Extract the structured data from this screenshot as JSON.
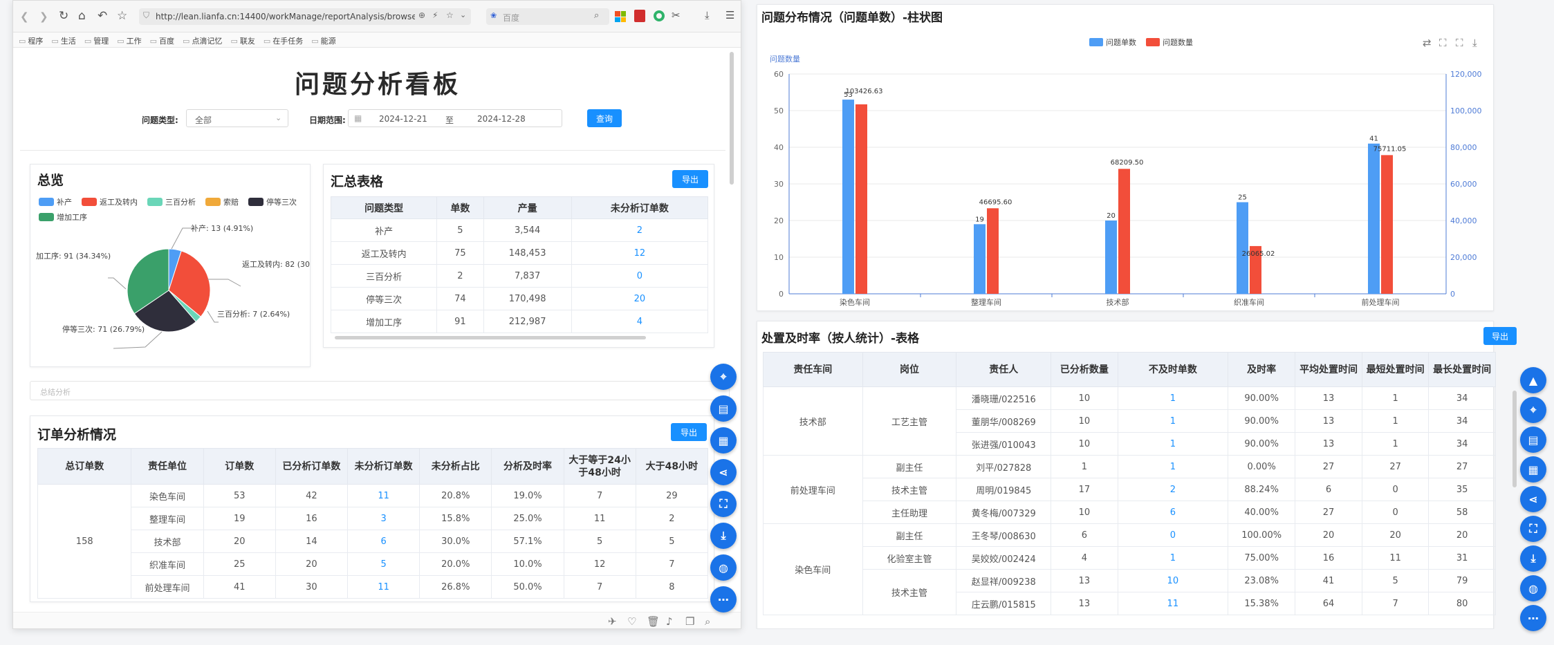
{
  "browser": {
    "url": "http://lean.lianfa.cn:14400/workManage/reportAnalysis/browse",
    "search_placeholder": "百度",
    "bookmarks": [
      "程序",
      "生活",
      "管理",
      "工作",
      "百度",
      "点滴记忆",
      "联友",
      "在手任务",
      "能源"
    ]
  },
  "page": {
    "title": "问题分析看板",
    "filter_type_label": "问题类型:",
    "filter_type_value": "全部",
    "filter_date_label": "日期范围:",
    "date_start": "2024-12-21",
    "date_sep": "至",
    "date_end": "2024-12-28",
    "query_label": "查询"
  },
  "overview": {
    "title": "总览",
    "legend": [
      {
        "name": "补产",
        "color": "#4e9df5"
      },
      {
        "name": "返工及转内",
        "color": "#f24e3a"
      },
      {
        "name": "三百分析",
        "color": "#6ad6b8"
      },
      {
        "name": "索赔",
        "color": "#f0a93a"
      },
      {
        "name": "停等三次",
        "color": "#2f2e3b"
      },
      {
        "name": "增加工序",
        "color": "#3aa06a"
      }
    ],
    "labels": [
      "补产: 13 (4.91%)",
      "返工及转内: 82 (30",
      "三百分析: 7 (2.64%)",
      "停等三次: 71 (26.79%)",
      "加工序: 91 (34.34%)"
    ]
  },
  "summary": {
    "title": "汇总表格",
    "export_label": "导出",
    "headers": [
      "问题类型",
      "单数",
      "产量",
      "未分析订单数"
    ],
    "rows": [
      [
        "补产",
        "5",
        "3,544",
        "2"
      ],
      [
        "返工及转内",
        "75",
        "148,453",
        "12"
      ],
      [
        "三百分析",
        "2",
        "7,837",
        "0"
      ],
      [
        "停等三次",
        "74",
        "170,498",
        "20"
      ],
      [
        "增加工序",
        "91",
        "212,987",
        "4"
      ]
    ]
  },
  "summary_input": {
    "placeholder": "总结分析"
  },
  "order": {
    "title": "订单分析情况",
    "export_label": "导出",
    "headers": [
      "总订单数",
      "责任单位",
      "订单数",
      "已分析订单数",
      "未分析订单数",
      "未分析占比",
      "分析及时率",
      "大于等于24小于48小时",
      "大于48小时"
    ],
    "total": "158",
    "rows": [
      [
        "染色车间",
        "53",
        "42",
        "11",
        "20.8%",
        "19.0%",
        "7",
        "29"
      ],
      [
        "整理车间",
        "19",
        "16",
        "3",
        "15.8%",
        "25.0%",
        "11",
        "2"
      ],
      [
        "技术部",
        "20",
        "14",
        "6",
        "30.0%",
        "57.1%",
        "5",
        "5"
      ],
      [
        "织准车间",
        "25",
        "20",
        "5",
        "20.0%",
        "10.0%",
        "12",
        "7"
      ],
      [
        "前处理车间",
        "41",
        "30",
        "11",
        "26.8%",
        "50.0%",
        "7",
        "8"
      ]
    ]
  },
  "chart_data": {
    "type": "bar",
    "title": "问题分布情况（问题单数）-柱状图",
    "ylabel": "问题数量",
    "categories": [
      "染色车间",
      "整理车间",
      "技术部",
      "织准车间",
      "前处理车间"
    ],
    "ylim": [
      0,
      60
    ],
    "y2lim": [
      0,
      120000
    ],
    "yticks": [
      "0",
      "10",
      "20",
      "30",
      "40",
      "50",
      "60"
    ],
    "y2ticks": [
      "0",
      "20,000",
      "40,000",
      "60,000",
      "80,000",
      "100,000",
      "120,000"
    ],
    "series": [
      {
        "name": "问题单数",
        "color": "#4e9df5",
        "axis": "left",
        "values": [
          53,
          19,
          20,
          25,
          41
        ],
        "labels": [
          "53",
          "19",
          "20",
          "25",
          "41"
        ]
      },
      {
        "name": "问题数量",
        "color": "#f24e3a",
        "axis": "right",
        "values": [
          103426.63,
          46695.6,
          68209.5,
          26065.02,
          75711.05
        ],
        "labels": [
          "103426.63",
          "46695.60",
          "68209.50",
          "26065.02",
          "75711.05"
        ]
      }
    ],
    "legend_position": "top-center"
  },
  "rate": {
    "title": "处置及时率（按人统计）-表格",
    "export_label": "导出",
    "headers": [
      "责任车间",
      "岗位",
      "责任人",
      "已分析数量",
      "不及时单数",
      "及时率",
      "平均处置时间",
      "最短处置时间",
      "最长处置时间"
    ],
    "groups": [
      {
        "dept": "技术部",
        "posts": [
          {
            "post": "工艺主管",
            "people": [
              [
                "潘晓珊/022516",
                "10",
                "1",
                "90.00%",
                "13",
                "1",
                "34"
              ],
              [
                "董朋华/008269",
                "10",
                "1",
                "90.00%",
                "13",
                "1",
                "34"
              ],
              [
                "张进强/010043",
                "10",
                "1",
                "90.00%",
                "13",
                "1",
                "34"
              ]
            ]
          }
        ]
      },
      {
        "dept": "前处理车间",
        "posts": [
          {
            "post": "副主任",
            "people": [
              [
                "刘平/027828",
                "1",
                "1",
                "0.00%",
                "27",
                "27",
                "27"
              ]
            ]
          },
          {
            "post": "技术主管",
            "people": [
              [
                "周明/019845",
                "17",
                "2",
                "88.24%",
                "6",
                "0",
                "35"
              ]
            ]
          },
          {
            "post": "主任助理",
            "people": [
              [
                "黄冬梅/007329",
                "10",
                "6",
                "40.00%",
                "27",
                "0",
                "58"
              ]
            ]
          }
        ]
      },
      {
        "dept": "染色车间",
        "posts": [
          {
            "post": "副主任",
            "people": [
              [
                "王冬琴/008630",
                "6",
                "0",
                "100.00%",
                "20",
                "20",
                "20"
              ]
            ]
          },
          {
            "post": "化验室主管",
            "people": [
              [
                "吴姣姣/002424",
                "4",
                "1",
                "75.00%",
                "16",
                "11",
                "31"
              ]
            ]
          },
          {
            "post": "技术主管",
            "people": [
              [
                "赵显祥/009238",
                "13",
                "10",
                "23.08%",
                "41",
                "5",
                "79"
              ],
              [
                "庄云鹏/015815",
                "13",
                "11",
                "15.38%",
                "64",
                "7",
                "80"
              ]
            ]
          }
        ]
      }
    ]
  },
  "colors": {
    "accent": "#1890ff",
    "fab": "#1a73e8"
  }
}
